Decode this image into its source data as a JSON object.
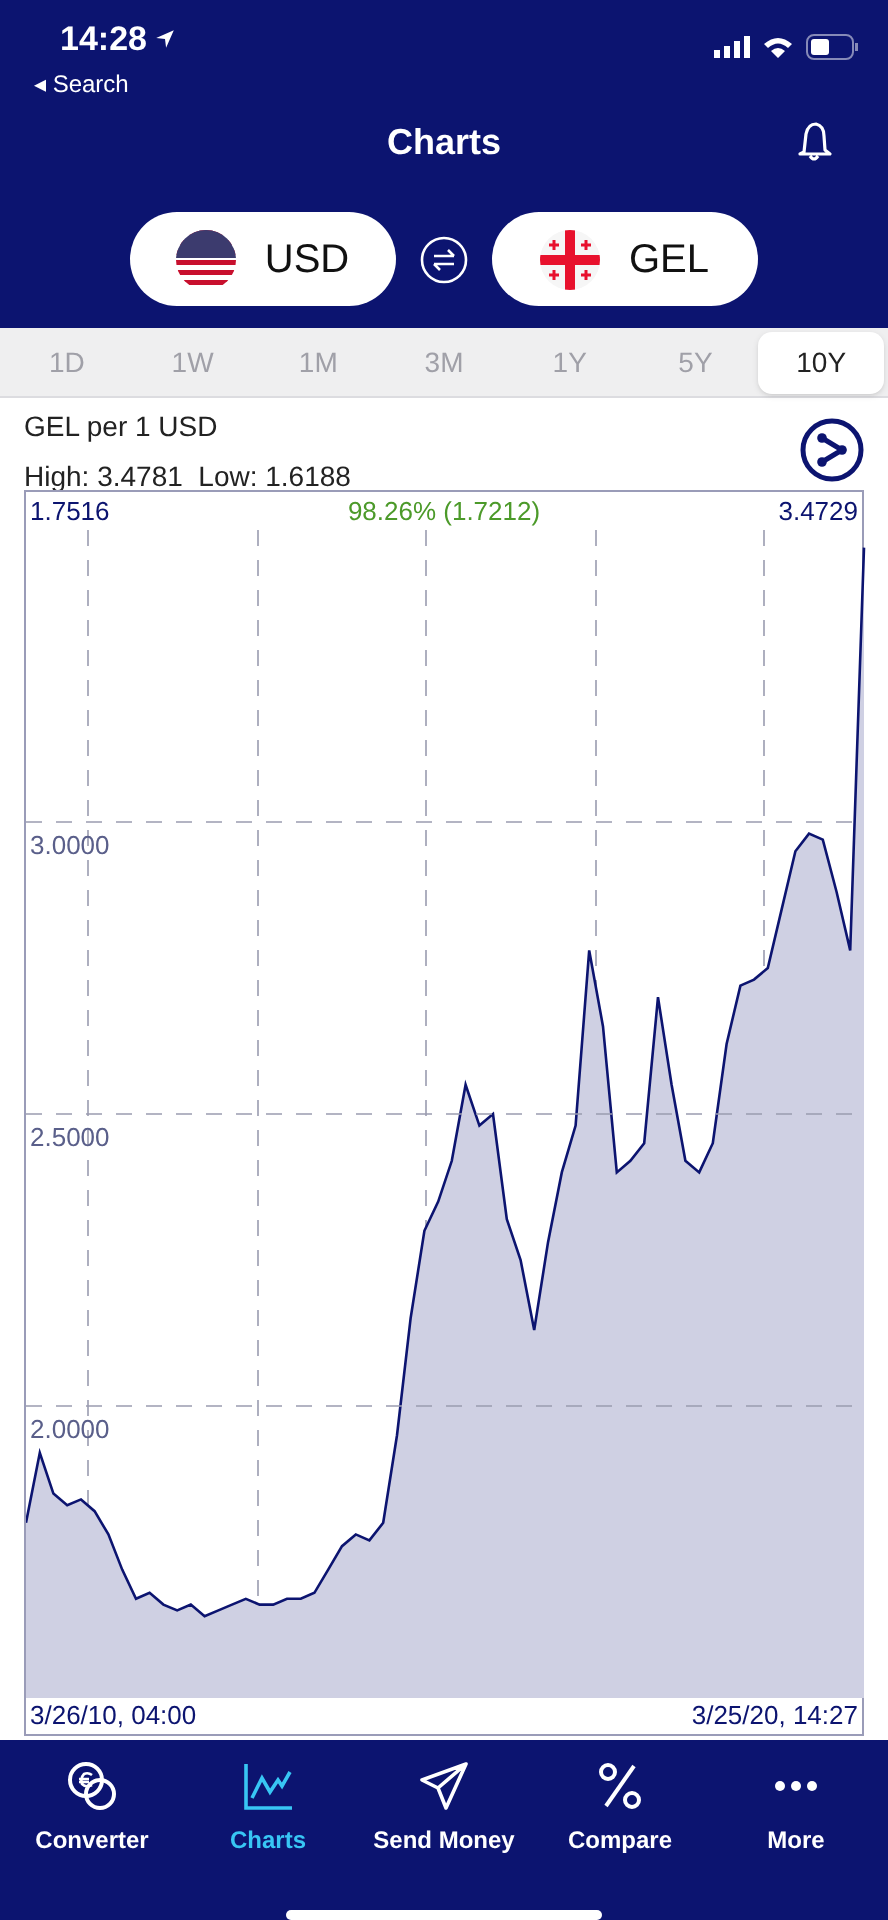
{
  "status_bar": {
    "time": "14:28",
    "back_label": "◂ Search"
  },
  "header": {
    "title": "Charts"
  },
  "currencies": [
    {
      "kind": "us",
      "code": "USD"
    },
    {
      "kind": "ge",
      "code": "GEL"
    }
  ],
  "periods": [
    {
      "label": "1D",
      "selected": false
    },
    {
      "label": "1W",
      "selected": false
    },
    {
      "label": "1M",
      "selected": false
    },
    {
      "label": "3M",
      "selected": false
    },
    {
      "label": "1Y",
      "selected": false
    },
    {
      "label": "5Y",
      "selected": false
    },
    {
      "label": "10Y",
      "selected": true
    }
  ],
  "chart": {
    "subtitle": "GEL per 1 USD",
    "high_low": "High: 3.4781  Low: 1.6188",
    "start_value": "1.7516",
    "change": "98.26% (1.7212)",
    "end_value": "3.4729",
    "start_date": "3/26/10, 04:00",
    "end_date": "3/25/20, 14:27",
    "chart_data": {
      "type": "area",
      "grid": true,
      "ylim": [
        1.5,
        3.5
      ],
      "yticks": [
        {
          "value": 2,
          "label": "2.0000"
        },
        {
          "value": 2.5,
          "label": "2.5000"
        },
        {
          "value": 3,
          "label": "3.0000"
        }
      ],
      "series": [
        {
          "color": "#0c1470",
          "values": [
            1.8,
            1.92,
            1.85,
            1.83,
            1.84,
            1.82,
            1.78,
            1.72,
            1.67,
            1.68,
            1.66,
            1.65,
            1.66,
            1.64,
            1.65,
            1.66,
            1.67,
            1.66,
            1.66,
            1.67,
            1.67,
            1.68,
            1.72,
            1.76,
            1.78,
            1.77,
            1.8,
            1.95,
            2.15,
            2.3,
            2.35,
            2.42,
            2.55,
            2.48,
            2.5,
            2.32,
            2.25,
            2.13,
            2.28,
            2.4,
            2.48,
            2.78,
            2.65,
            2.4,
            2.42,
            2.45,
            2.7,
            2.55,
            2.42,
            2.4,
            2.45,
            2.62,
            2.72,
            2.73,
            2.75,
            2.85,
            2.95,
            2.98,
            2.97,
            2.88,
            2.78,
            3.47
          ]
        }
      ]
    }
  },
  "nav": [
    {
      "kind": "converter",
      "label": "Converter",
      "selected": false
    },
    {
      "kind": "charts",
      "label": "Charts",
      "selected": true
    },
    {
      "kind": "send",
      "label": "Send Money",
      "selected": false
    },
    {
      "kind": "compare",
      "label": "Compare",
      "selected": false
    },
    {
      "kind": "more",
      "label": "More",
      "selected": false
    }
  ]
}
